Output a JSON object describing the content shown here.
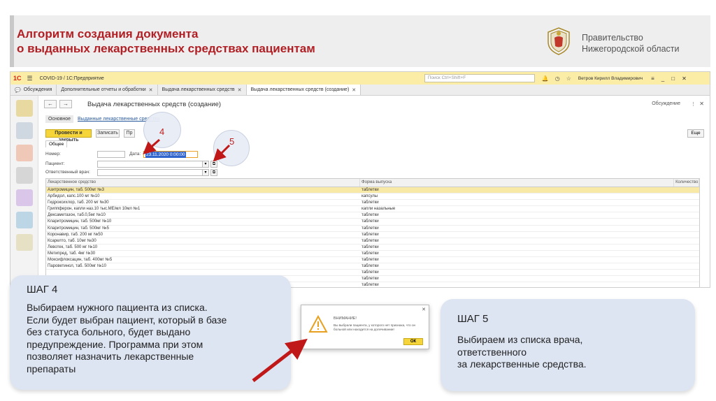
{
  "slide": {
    "title_line1": "Алгоритм создания документа",
    "title_line2": "о выданных лекарственных средствах пациентам",
    "gov_line1": "Правительство",
    "gov_line2": "Нижегородской области"
  },
  "app": {
    "logo": "1С",
    "window_title": "COVID-19 /  1С:Предприятие",
    "search_placeholder": "Поиск Ctrl+Shift+F",
    "user_name": "Ветров Кирилл Владимирович",
    "tabs": [
      {
        "label": "Обсуждения"
      },
      {
        "label": "Дополнительные отчеты и обработки"
      },
      {
        "label": "Выдача лекарственных средств"
      },
      {
        "label": "Выдача лекарственных средств (создание)"
      }
    ],
    "form": {
      "title": "Выдача лекарственных средств (создание)",
      "discuss_label": "Обсуждение",
      "subtab_main": "Основное",
      "subtab_link": "Выданные лекарственные средства",
      "post_close": "Провести и закрыть",
      "write": "Записать",
      "print": "Пр",
      "more": "Еще",
      "group_tab": "Общее",
      "number_label": "Номер:",
      "date_label": "Дата:",
      "date_value": "23.11.2020  0:00:00",
      "patient_label": "Пациент:",
      "doctor_label": "Ответственный врач:"
    },
    "table": {
      "columns": [
        "Лекарственное средство",
        "Форма выпуска",
        "Количество"
      ],
      "rows": [
        [
          "Азитромицин, таб. 500мг №3",
          "таблетки"
        ],
        [
          "Арбидол, капс.100 мг №10",
          "капсулы"
        ],
        [
          "Гидроксихлор, таб. 200 мг №30",
          "таблетки"
        ],
        [
          "Гриппферон, капли наз.10 тыс.МЕ/мл 10мл №1",
          "капли назальные"
        ],
        [
          "Дексаметазон, таб.0,5мг №10",
          "таблетки"
        ],
        [
          "Кларитромицин, таб. 500мг №10",
          "таблетки"
        ],
        [
          "Кларитромицин, таб. 500мг №5",
          "таблетки"
        ],
        [
          "Коронавир, таб. 200 мг №50",
          "таблетки"
        ],
        [
          "Ксарелто, таб. 10мг №30",
          "таблетки"
        ],
        [
          "Левотек, таб. 500 мг №10",
          "таблетки"
        ],
        [
          "Метипред, таб. 4мг №30",
          "таблетки"
        ],
        [
          "Моксифлоксацин, таб. 400мг №5",
          "таблетки"
        ],
        [
          "Пароветинол, таб. 500мг №10",
          "таблетки"
        ],
        [
          "",
          "таблетки"
        ],
        [
          "",
          "таблетки"
        ],
        [
          "",
          "таблетки"
        ]
      ]
    }
  },
  "badges": {
    "step4": "4",
    "step5": "5"
  },
  "step4": {
    "title": "ШАГ 4",
    "text_lines": [
      "Выбираем нужного пациента из списка.",
      "Если будет выбран пациент, который в базе",
      "без статуса больного, будет выдано",
      "предупреждение. Программа при этом",
      "позволяет назначить лекарственные",
      "препараты"
    ]
  },
  "step5": {
    "title": "ШАГ 5",
    "text_lines": [
      "Выбираем из списка врача,",
      "ответственного",
      "за лекарственные средства."
    ]
  },
  "dialog": {
    "title": "ВНИМАНИЕ!",
    "message": "Вы выбрали пациента, у которого нет признака, что он больной или находится на долечивании!",
    "ok": "ОК"
  },
  "colors": {
    "title_red": "#b11f24",
    "topbar_yellow": "#fbeda6",
    "primary_button": "#f5d53a",
    "card_blue": "#dde4f2",
    "arrow_red": "#c01818"
  }
}
